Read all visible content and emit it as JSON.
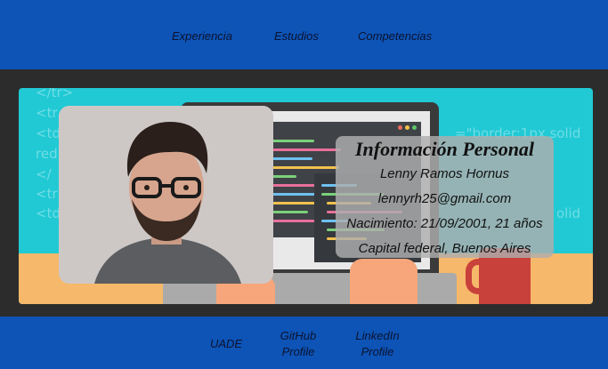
{
  "nav": {
    "experiencia": "Experiencia",
    "estudios": "Estudios",
    "competencias": "Competencias"
  },
  "banner": {
    "code_lines": [
      "</tr>",
      "<tr",
      "<td",
      "red",
      "</",
      "<tr",
      "<td"
    ],
    "code_right": "=\"border:1px solid",
    "code_right2": "olid"
  },
  "info": {
    "title": "Información Personal",
    "name": "Lenny Ramos Hornus",
    "email": "lennyrh25@gmail.com",
    "birth": "Nacimiento: 21/09/2001, 21 años",
    "location": "Capital federal, Buenos Aires"
  },
  "footer": {
    "uade": "UADE",
    "github_line1": "GitHub",
    "github_line2": "Profile",
    "linkedin_line1": "LinkedIn",
    "linkedin_line2": "Profile"
  },
  "colors": {
    "header_bg": "#0d54b6",
    "main_bg": "#2c2c2c",
    "banner_sky": "#21c9d4"
  }
}
